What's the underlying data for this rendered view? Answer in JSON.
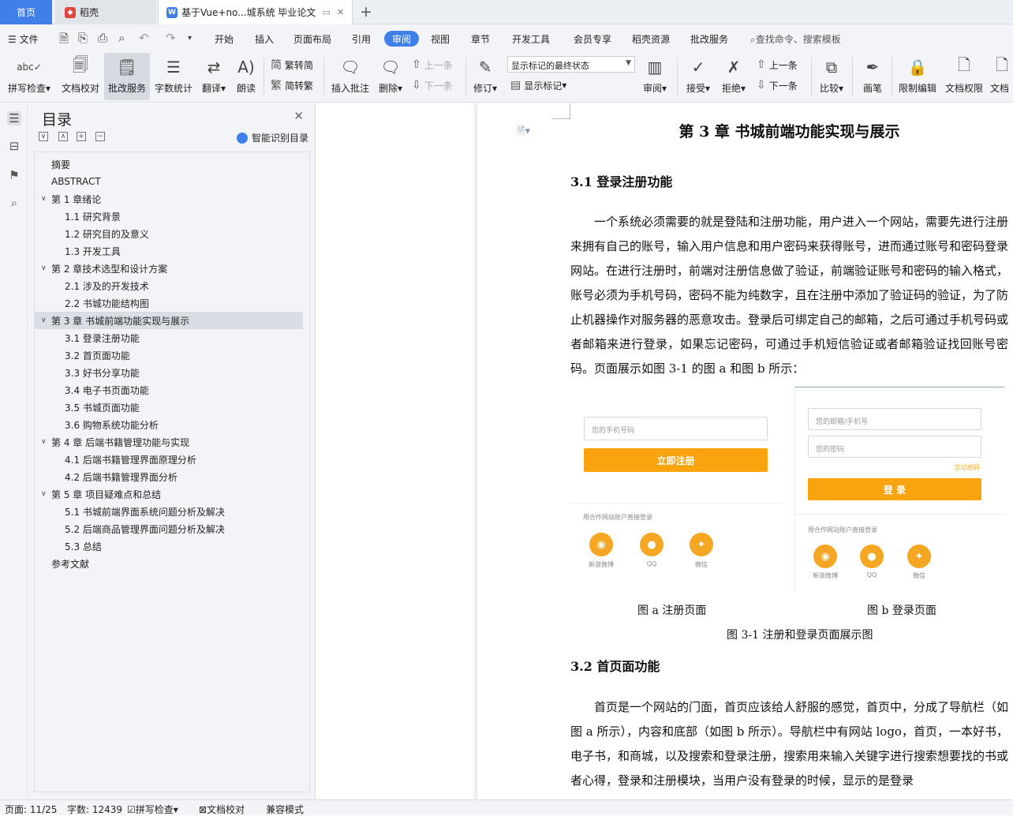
{
  "tabs": {
    "home": "首页",
    "daoke": "稻壳",
    "doc": "基于Vue+no...城系统 毕业论文",
    "add": "+"
  },
  "menu": {
    "file": "文件",
    "items": [
      "开始",
      "插入",
      "页面布局",
      "引用",
      "审阅",
      "视图",
      "章节",
      "开发工具",
      "会员专享",
      "稻壳资源",
      "批改服务"
    ],
    "search": "查找命令、搜索模板"
  },
  "ribbon": {
    "spellcheck": "拼写检查",
    "doccheck": "文档校对",
    "correct": "批改服务",
    "wordcount": "字数统计",
    "translate": "翻译",
    "read": "朗读",
    "trad": "繁转简",
    "simp": "简转繁",
    "insert_comment": "插入批注",
    "delete": "删除",
    "prev": "上一条",
    "next": "下一条",
    "track": "修订",
    "track_state": "显示标记的最终状态",
    "show_marks": "显示标记",
    "review": "审阅",
    "accept": "接受",
    "reject": "拒绝",
    "prev2": "上一条",
    "next2": "下一条",
    "compare": "比较",
    "pen": "画笔",
    "restrict": "限制编辑",
    "perm": "文档权限",
    "docmore": "文档"
  },
  "toc": {
    "title": "目录",
    "smart": "智能识别目录",
    "items": [
      {
        "text": "摘要",
        "level": 0,
        "caret": ""
      },
      {
        "text": "ABSTRACT",
        "level": 0,
        "caret": ""
      },
      {
        "text": "第 1 章绪论",
        "level": 0,
        "caret": "∨"
      },
      {
        "text": "1.1  研究背景",
        "level": 1,
        "caret": ""
      },
      {
        "text": "1.2  研究目的及意义",
        "level": 1,
        "caret": ""
      },
      {
        "text": "1.3  开发工具",
        "level": 1,
        "caret": ""
      },
      {
        "text": "第 2 章技术选型和设计方案",
        "level": 0,
        "caret": "∨"
      },
      {
        "text": "2.1  涉及的开发技术",
        "level": 1,
        "caret": ""
      },
      {
        "text": "2.2  书城功能结构图",
        "level": 1,
        "caret": ""
      },
      {
        "text": "第 3 章  书城前端功能实现与展示",
        "level": 0,
        "caret": "∨",
        "selected": true
      },
      {
        "text": "3.1  登录注册功能",
        "level": 1,
        "caret": ""
      },
      {
        "text": "3.2  首页面功能",
        "level": 1,
        "caret": ""
      },
      {
        "text": "3.3  好书分享功能",
        "level": 1,
        "caret": ""
      },
      {
        "text": "3.4  电子书页面功能",
        "level": 1,
        "caret": ""
      },
      {
        "text": "3.5  书城页面功能",
        "level": 1,
        "caret": ""
      },
      {
        "text": "3.6  购物系统功能分析",
        "level": 1,
        "caret": ""
      },
      {
        "text": "第 4 章  后端书籍管理功能与实现",
        "level": 0,
        "caret": "∨"
      },
      {
        "text": "4.1  后端书籍管理界面原理分析",
        "level": 1,
        "caret": ""
      },
      {
        "text": "4.2  后端书籍管理界面分析",
        "level": 1,
        "caret": ""
      },
      {
        "text": "第 5 章  项目疑难点和总结",
        "level": 0,
        "caret": "∨"
      },
      {
        "text": "5.1  书城前端界面系统问题分析及解决",
        "level": 1,
        "caret": ""
      },
      {
        "text": "5.2  后端商品管理界面问题分析及解决",
        "level": 1,
        "caret": ""
      },
      {
        "text": "5.3  总结",
        "level": 1,
        "caret": ""
      },
      {
        "text": "参考文献",
        "level": 0,
        "caret": ""
      }
    ]
  },
  "doc": {
    "chapter": "第 3 章  书城前端功能实现与展示",
    "h31": "3.1  登录注册功能",
    "p1": "一个系统必须需要的就是登陆和注册功能，用户进入一个网站，需要先进行注册来拥有自己的账号，输入用户信息和用户密码来获得账号，进而通过账号和密码登录网站。在进行注册时，前端对注册信息做了验证，前端验证账号和密码的输入格式，账号必须为手机号码，密码不能为纯数字，且在注册中添加了验证码的验证，为了防止机器操作对服务器的恶意攻击。登录后可绑定自己的邮箱，之后可通过手机号码或者邮箱来进行登录，如果忘记密码，可通过手机短信验证或者邮箱验证找回账号密码。页面展示如图 3-1 的图 a 和图 b 所示：",
    "fig_a": {
      "phone_ph": "您的手机号码",
      "register": "立即注册",
      "coop": "用合作网站账户直接登录",
      "weibo": "新浪微博",
      "qq": "QQ",
      "wechat": "微信"
    },
    "fig_b": {
      "email_ph": "您的邮箱/手机号",
      "pwd_ph": "您的密码",
      "forgot": "忘记密码",
      "login": "登 录",
      "coop": "用合作网站账户直接登录",
      "weibo": "新浪微博",
      "qq": "QQ",
      "wechat": "微信"
    },
    "cap_a": "图 a   注册页面",
    "cap_b": "图 b   登录页面",
    "cap_fig": "图 3-1   注册和登录页面展示图",
    "h32": "3.2  首页面功能",
    "p2": "首页是一个网站的门面，首页应该给人舒服的感觉，首页中，分成了导航栏（如图 a 所示），内容和底部（如图 b 所示）。导航栏中有网站 logo，首页，一本好书，电子书，和商城，以及搜索和登录注册，搜索用来输入关键字进行搜索想要找的书或者心得，登录和注册模块，当用户没有登录的时候，显示的是登录"
  },
  "status": {
    "page": "页面: 11/25",
    "words": "字数: 12439",
    "spell": "拼写检查",
    "proof": "文档校对",
    "compat": "兼容模式"
  },
  "colors": {
    "accent": "#3f7fe8",
    "orange": "#f9a40f"
  }
}
